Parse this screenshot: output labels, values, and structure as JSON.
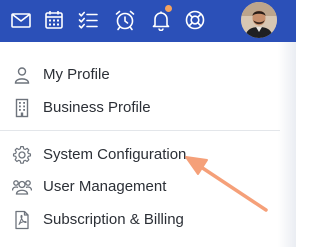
{
  "topbar": {
    "icons": [
      "mail-icon",
      "calendar-icon",
      "checklist-icon",
      "alarm-clock-icon",
      "bell-icon",
      "lifebuoy-icon"
    ],
    "notification_dot_color": "#f5a25d",
    "background_color": "#2b50b8"
  },
  "menu": {
    "items": [
      {
        "label": "My Profile",
        "icon": "user-icon"
      },
      {
        "label": "Business Profile",
        "icon": "building-icon"
      },
      {
        "label": "System Configuration",
        "icon": "gear-icon"
      },
      {
        "label": "User Management",
        "icon": "users-icon"
      },
      {
        "label": "Subscription & Billing",
        "icon": "pdf-document-icon"
      }
    ]
  },
  "annotation": {
    "arrow_color": "#f5a079",
    "points_to": "System Configuration"
  }
}
